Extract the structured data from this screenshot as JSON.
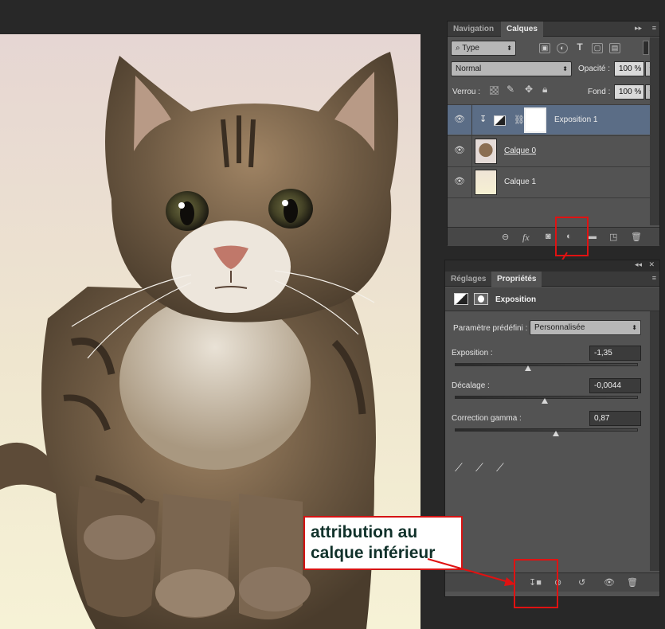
{
  "layers_panel": {
    "tabs": [
      "Navigation",
      "Calques"
    ],
    "collapse_label": "▸▸",
    "menu_label": "≡",
    "filter": {
      "label": "Type",
      "icon": "search-icon"
    },
    "filter_icons": [
      "image-filter-icon",
      "adjustment-filter-icon",
      "text-filter-icon",
      "shape-filter-icon",
      "smart-object-filter-icon"
    ],
    "blend_mode": "Normal",
    "opacity_label": "Opacité :",
    "opacity_value": "100 %",
    "lock_label": "Verrou :",
    "fill_label": "Fond :",
    "fill_value": "100 %",
    "layers": [
      {
        "name": "Exposition 1",
        "selected": true,
        "type": "adjustment"
      },
      {
        "name": "Calque 0",
        "selected": false,
        "type": "image"
      },
      {
        "name": "Calque 1",
        "selected": false,
        "type": "fill"
      }
    ],
    "bottom_icons": [
      "link-icon",
      "fx-icon",
      "mask-icon",
      "adjustment-layer-icon",
      "folder-icon",
      "new-layer-icon",
      "trash-icon"
    ],
    "fx_label": "fx"
  },
  "properties_panel": {
    "tabs": [
      "Réglages",
      "Propriétés"
    ],
    "header_title": "Exposition",
    "preset_label": "Paramètre prédéfini :",
    "preset_value": "Personnalisée",
    "sliders": [
      {
        "label": "Exposition :",
        "value": "-1,35",
        "position": 0.4
      },
      {
        "label": "Décalage :",
        "value": "-0,0044",
        "position": 0.49
      },
      {
        "label": "Correction gamma :",
        "value": "0,87",
        "position": 0.55
      }
    ],
    "bottom_icons": [
      "clip-to-layer-icon",
      "view-previous-icon",
      "reset-icon",
      "visibility-icon",
      "trash-icon"
    ]
  },
  "annotation": {
    "line1": "attribution au",
    "line2": "calque inférieur"
  },
  "colors": {
    "panel_bg": "#535353",
    "selected_layer": "#5b6d86",
    "annotation_red": "#e01212"
  }
}
